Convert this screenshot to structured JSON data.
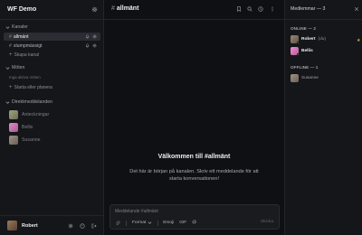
{
  "workspace": {
    "name": "WF Demo"
  },
  "sidebar": {
    "channels_heading": "Kanaler",
    "channels": [
      {
        "name": "allmänt",
        "active": true
      },
      {
        "name": "slumpmässigt",
        "active": false
      }
    ],
    "create_channel": "Skapa kanal",
    "meetings_heading": "Möten",
    "meetings_empty": "Inga aktiva möten",
    "start_meeting": "Starta eller planera",
    "dm_heading": "Direktmeddelanden",
    "dms": [
      {
        "name": "Anteckningar",
        "avatar_color": "#8a8c70"
      },
      {
        "name": "Bellis",
        "avatar_color": "#c07ab0"
      },
      {
        "name": "Susanne",
        "avatar_color": "#8a7f72"
      }
    ]
  },
  "user": {
    "name": "Robert"
  },
  "channel_header": {
    "hash": "#",
    "name": "allmänt"
  },
  "welcome": {
    "title": "Välkommen till #allmänt",
    "description": "Det här är början på kanalen. Skriv ett meddelande för att starta konversationen!"
  },
  "composer": {
    "placeholder": "Meddelande #allmänt",
    "format_label": "Format",
    "emoji_label": "Emoji",
    "gif_label": "GIF",
    "mention_label": "@",
    "send_label": "Skicka"
  },
  "members": {
    "title": "Medlemmar — 3",
    "online_heading": "ONLINE — 2",
    "online": [
      {
        "name": "Robert",
        "suffix": "(du)",
        "avatar_color": "#7a6a5a",
        "status_color": "#3fb950"
      },
      {
        "name": "Bellis",
        "suffix": "",
        "avatar_color": "#d86aa8",
        "status_color": "#3fb950"
      }
    ],
    "offline_heading": "OFFLINE — 1",
    "offline": [
      {
        "name": "Susanne",
        "avatar_color": "#8a7f72"
      }
    ]
  },
  "colors": {
    "background": "#0f1013",
    "sidebar": "#151619",
    "active_item": "#2b2d33",
    "online_status": "#3fb950",
    "star": "#d9a53b"
  }
}
